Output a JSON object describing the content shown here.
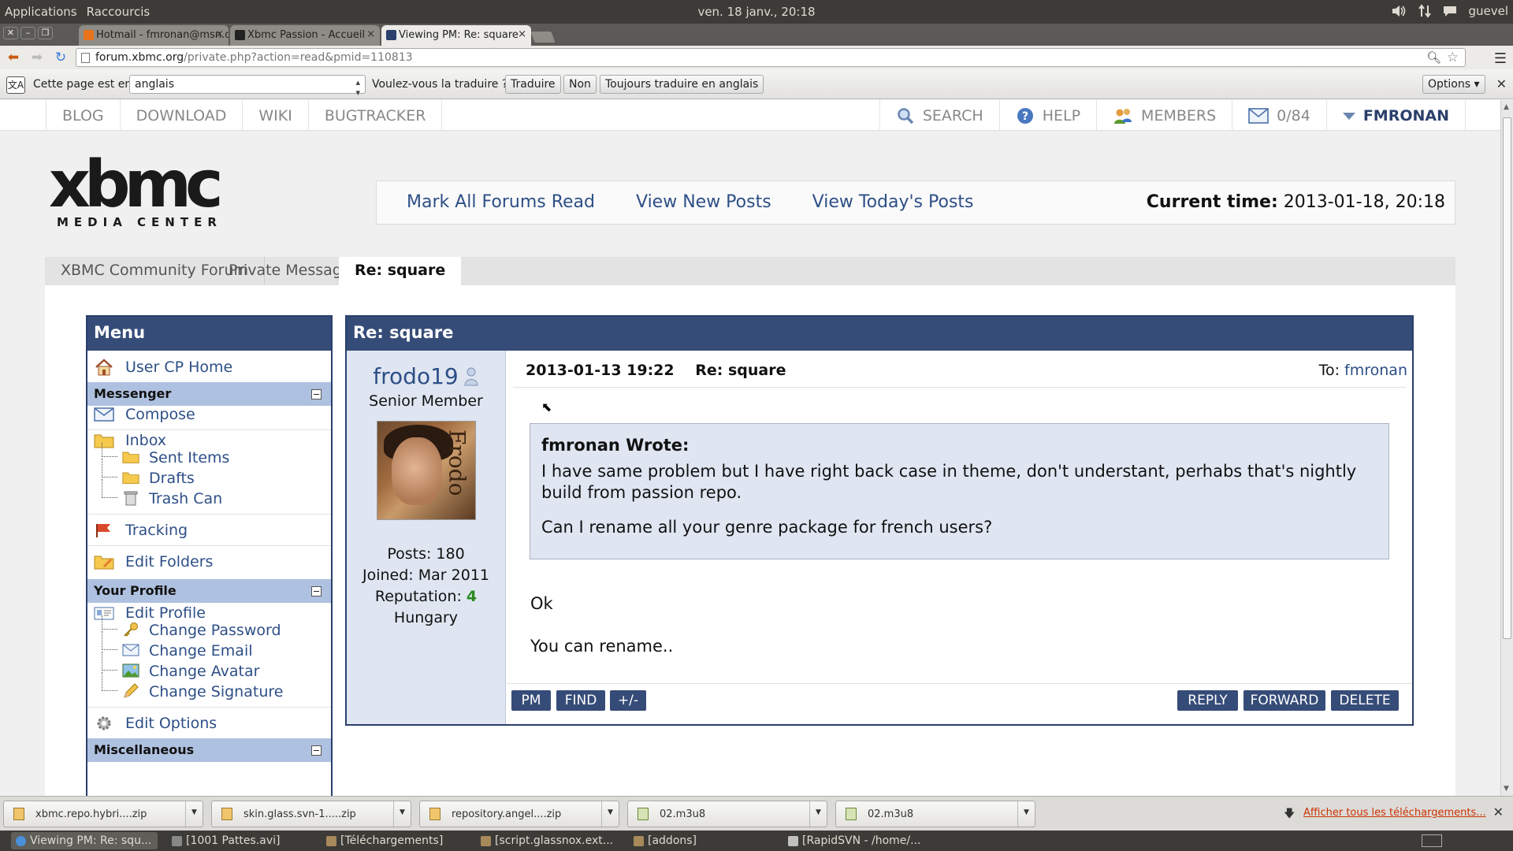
{
  "os_panel": {
    "menu_applications": "Applications",
    "menu_shortcuts": "Raccourcis",
    "clock": "ven. 18 janv., 20:18",
    "user": "guevel"
  },
  "browser": {
    "tabs": [
      {
        "title": "Hotmail - fmronan@msn.c",
        "favicon_color": "#e8731a"
      },
      {
        "title": "Xbmc Passion - Accueil",
        "favicon_color": "#222222"
      },
      {
        "title": "Viewing PM: Re: square",
        "favicon_color": "#2a3f6b"
      }
    ],
    "url_host": "forum.xbmc.org",
    "url_path": "/private.php?action=read&pmid=110813"
  },
  "translate_bar": {
    "page_in_label": "Cette page est en",
    "language": "anglais",
    "question": "Voulez-vous la traduire ?",
    "translate_btn": "Traduire",
    "no_btn": "Non",
    "always_btn": "Toujours traduire en anglais",
    "options_btn": "Options"
  },
  "site": {
    "nav_left": [
      "BLOG",
      "DOWNLOAD",
      "WIKI",
      "BUGTRACKER"
    ],
    "nav_search": "SEARCH",
    "nav_help": "HELP",
    "nav_members": "MEMBERS",
    "nav_pm_count": "0/84",
    "nav_user": "FMRONAN",
    "logo_main": "xbmc",
    "logo_sub": "MEDIA CENTER",
    "links": [
      "Mark All Forums Read",
      "View New Posts",
      "View Today's Posts"
    ],
    "time_label": "Current time:",
    "time_value": "2013-01-18, 20:18",
    "breadcrumb": [
      "XBMC Community Forum",
      "Private Messages",
      "Re: square"
    ]
  },
  "menu": {
    "title": "Menu",
    "user_cp": "User CP Home",
    "messenger": "Messenger",
    "compose": "Compose",
    "inbox": "Inbox",
    "sent": "Sent Items",
    "drafts": "Drafts",
    "trash": "Trash Can",
    "tracking": "Tracking",
    "edit_folders": "Edit Folders",
    "your_profile": "Your Profile",
    "edit_profile": "Edit Profile",
    "change_password": "Change Password",
    "change_email": "Change Email",
    "change_avatar": "Change Avatar",
    "change_signature": "Change Signature",
    "edit_options": "Edit Options",
    "misc": "Miscellaneous"
  },
  "message": {
    "title": "Re: square",
    "author": "frodo19",
    "rank": "Senior Member",
    "avatar_text": "Frodo",
    "posts_label": "Posts:",
    "posts": "180",
    "joined_label": "Joined:",
    "joined": "Mar 2011",
    "rep_label": "Reputation:",
    "reputation": "4",
    "location": "Hungary",
    "date": "2013-01-13 19:22",
    "subject": "Re: square",
    "to_label": "To:",
    "to_user": "fmronan",
    "quote_author": "fmronan Wrote:",
    "quote_line1": "I have same problem but I have right back case in theme, don't understant, perhabs that's nightly build from passion repo.",
    "quote_line2": "Can I rename all your genre package for french users?",
    "body_line1": "Ok",
    "body_line2": "You can rename..",
    "btn_pm": "PM",
    "btn_find": "FIND",
    "btn_toggle": "+/-",
    "btn_reply": "REPLY",
    "btn_forward": "FORWARD",
    "btn_delete": "DELETE"
  },
  "downloads": {
    "items": [
      "xbmc.repo.hybri....zip",
      "skin.glass.svn-1.....zip",
      "repository.angel....zip",
      "02.m3u8",
      "02.m3u8"
    ],
    "show_all": "Afficher tous les téléchargements..."
  },
  "taskbar": {
    "items": [
      "Viewing PM: Re: squ...",
      "[1001 Pattes.avi]",
      "[Téléchargements]",
      "[script.glassnox.ext...",
      "[addons]",
      "[RapidSVN - /home/..."
    ]
  },
  "colors": {
    "header_blue": "#364c78",
    "link_blue": "#2d4f86",
    "section_blue": "#afc1e0",
    "panel_light": "#dfe6f2",
    "reputation_green": "#2a8a20"
  }
}
